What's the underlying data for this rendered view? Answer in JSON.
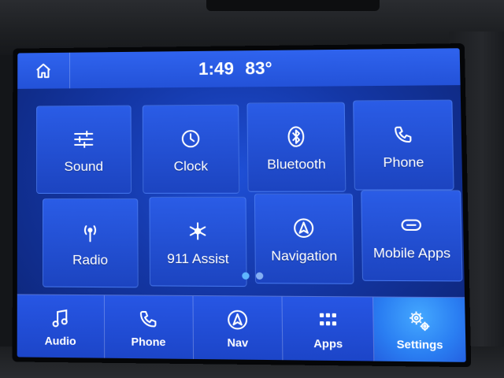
{
  "status_bar": {
    "time": "1:49",
    "temperature": "83°"
  },
  "tiles": [
    {
      "label": "Sound",
      "icon": "sliders-icon"
    },
    {
      "label": "Clock",
      "icon": "clock-icon"
    },
    {
      "label": "Bluetooth",
      "icon": "bluetooth-icon"
    },
    {
      "label": "Phone",
      "icon": "phone-icon"
    },
    {
      "label": "Radio",
      "icon": "radio-antenna-icon"
    },
    {
      "label": "911 Assist",
      "icon": "assist-asterisk-icon"
    },
    {
      "label": "Navigation",
      "icon": "navigation-arrow-icon"
    },
    {
      "label": "Mobile Apps",
      "icon": "mobile-apps-icon"
    }
  ],
  "page_indicator": {
    "count": 2,
    "active": 1
  },
  "dock": [
    {
      "label": "Audio",
      "icon": "music-note-icon"
    },
    {
      "label": "Phone",
      "icon": "phone-icon"
    },
    {
      "label": "Nav",
      "icon": "navigation-arrow-icon"
    },
    {
      "label": "Apps",
      "icon": "apps-grid-icon"
    },
    {
      "label": "Settings",
      "icon": "gears-icon",
      "active": true
    }
  ],
  "colors": {
    "accent": "#2a5ce6",
    "active": "#44a8ff",
    "dot": "#5fb6ff"
  }
}
